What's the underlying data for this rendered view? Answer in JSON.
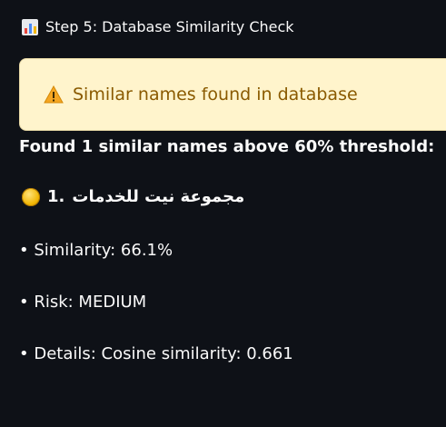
{
  "header": {
    "title": "Step 5: Database Similarity Check",
    "icon": "bar-chart-icon"
  },
  "warning": {
    "text": "Similar names found in database",
    "icon": "warning-icon",
    "background": "#fff4cc",
    "text_color": "#8a5a00"
  },
  "summary": {
    "text": "Found 1 similar names above 60% threshold:"
  },
  "match": {
    "index_label": "1.",
    "name": "مجموعة نيت للخدمات",
    "icon": "yellow-circle-icon",
    "similarity": "• Similarity: 66.1%",
    "risk": "• Risk: MEDIUM",
    "details": "• Details: Cosine similarity: 0.661"
  }
}
